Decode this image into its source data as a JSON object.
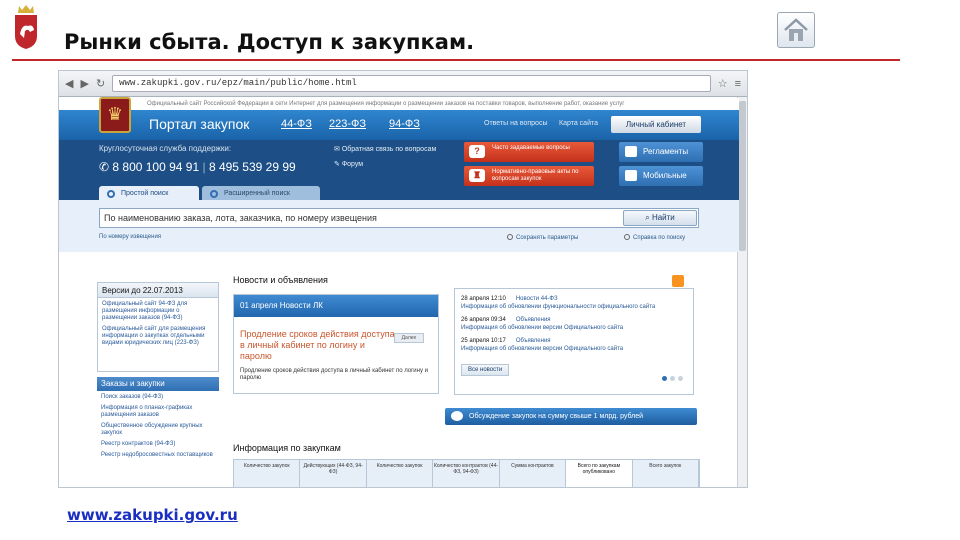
{
  "slide": {
    "title": "Рынки сбыта. Доступ к закупкам.",
    "footer_link": "www.zakupki.gov.ru",
    "accent_color": "#c0272d"
  },
  "browser": {
    "url": "www.zakupki.gov.ru/epz/main/public/home.html"
  },
  "portal": {
    "gov_strip": "Официальный сайт Российской Федерации в сети Интернет для размещения информации о размещении заказов на поставки товаров, выполнение работ, оказание услуг",
    "name": "Портал закупок",
    "laws": [
      "44-ФЗ",
      "223-ФЗ",
      "94-ФЗ"
    ],
    "top_links": [
      "Ответы на вопросы",
      "Карта сайта"
    ],
    "cabinet_button": "Личный кабинет",
    "support_label": "Круглосуточная служба поддержки:",
    "phone_1": "8 800 100 94 91",
    "phone_2": "8 495 539 29 99",
    "mid_links": [
      "Обратная связь по вопросам",
      "Форум"
    ],
    "red_buttons": [
      "Часто задаваемые вопросы",
      "Нормативно-правовые акты по вопросам закупок"
    ],
    "blue_buttons": [
      "Регламенты",
      "Мобильные"
    ],
    "tabs": [
      "Простой поиск",
      "Расширенный поиск"
    ],
    "search_placeholder": "По наименованию заказа, лота, заказчика, по номеру извещения",
    "find_button": "Найти",
    "search_sub_left": "По номеру извещения",
    "search_sub_opts": [
      "Сохранять параметры",
      "Справка по поиску"
    ]
  },
  "left": {
    "version_head": "Версии до 22.07.2013",
    "version_links": [
      "Официальный сайт 94-ФЗ для размещения информации о размещении заказов (94-ФЗ)",
      "Официальный сайт для размещения информации о закупках отдельными видами юридических лиц (223-ФЗ)"
    ],
    "orders_head": "Заказы и закупки",
    "order_links": [
      "Поиск заказов (94-ФЗ)",
      "Информация о планах-графиках размещения заказов",
      "Общественное обсуждение крупных закупок",
      "Реестр контрактов (94-ФЗ)",
      "Реестр недобросовестных поставщиков"
    ]
  },
  "news": {
    "title": "Новости и объявления",
    "card_head": "01 апреля   Новости ЛК",
    "card_big": "Продление сроков действия доступа в личный кабинет по логину и паролю",
    "card_small": "Продление сроков действия доступа в личный кабинет по логину и паролю",
    "more_tag": "Далее",
    "feed": [
      {
        "date": "28 апреля 12:10",
        "tag": "Новости 44-ФЗ",
        "text": "Информация об обновлении функциональности официального сайта"
      },
      {
        "date": "26 апреля 09:34",
        "tag": "Объявления",
        "text": "Информация об обновлении версии Официального сайта"
      },
      {
        "date": "25 апреля 10:17",
        "tag": "Объявления",
        "text": "Информация об обновлении версии Официального сайта"
      }
    ],
    "all_news": "Все новости",
    "discuss_button": "Обсуждение закупок на сумму свыше 1 млрд. рублей"
  },
  "info": {
    "title": "Информация по закупкам",
    "columns": [
      "Количество закупок",
      "Действующих (44-ФЗ, 94-ФЗ)",
      "Количество закупок",
      "Количество контрактов (44-ФЗ, 94-ФЗ)",
      "Сумма контрактов",
      "Всего по закупкам опубликовано",
      "Всего закупок"
    ]
  }
}
